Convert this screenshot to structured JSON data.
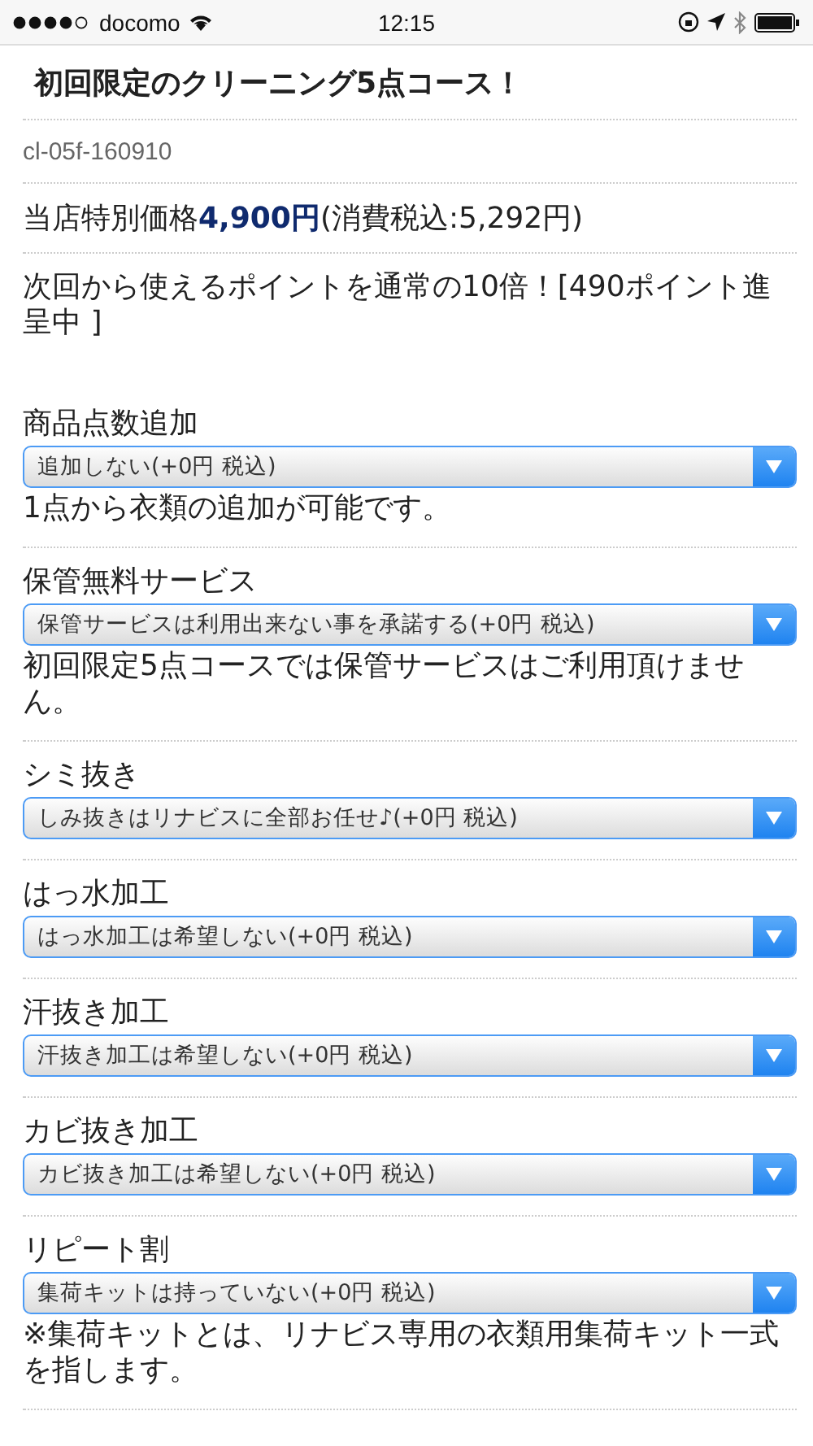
{
  "status_bar": {
    "carrier": "docomo",
    "time": "12:15"
  },
  "title": "初回限定のクリーニング5点コース！",
  "code": "cl-05f-160910",
  "price": "当店特別価格**4,900円**(消費税込:5,292円)",
  "points": "次回から使えるポイントを通常の10倍！[490ポイント進呈中 ]",
  "options": [
    {
      "label": "商品点数追加",
      "value": "追加しない(+0円 税込)",
      "note": "1点から衣類の追加が可能です。"
    },
    {
      "label": "保管無料サービス",
      "value": "保管サービスは利用出来ない事を承諾する(+0円 税込)",
      "note": "初回限定5点コースでは保管サービスはご利用頂けません。"
    },
    {
      "label": "シミ抜き",
      "value": "しみ抜きはリナビスに全部お任せ♪(+0円 税込)"
    },
    {
      "label": "はっ水加工",
      "value": "はっ水加工は希望しない(+0円 税込)"
    },
    {
      "label": "汗抜き加工",
      "value": "汗抜き加工は希望しない(+0円 税込)"
    },
    {
      "label": "カビ抜き加工",
      "value": "カビ抜き加工は希望しない(+0円 税込)"
    },
    {
      "label": "リピート割",
      "value": "集荷キットは持っていない(+0円 税込)",
      "note": "※集荷キットとは、リナビス専用の衣類用集荷キット一式を指します。"
    }
  ]
}
